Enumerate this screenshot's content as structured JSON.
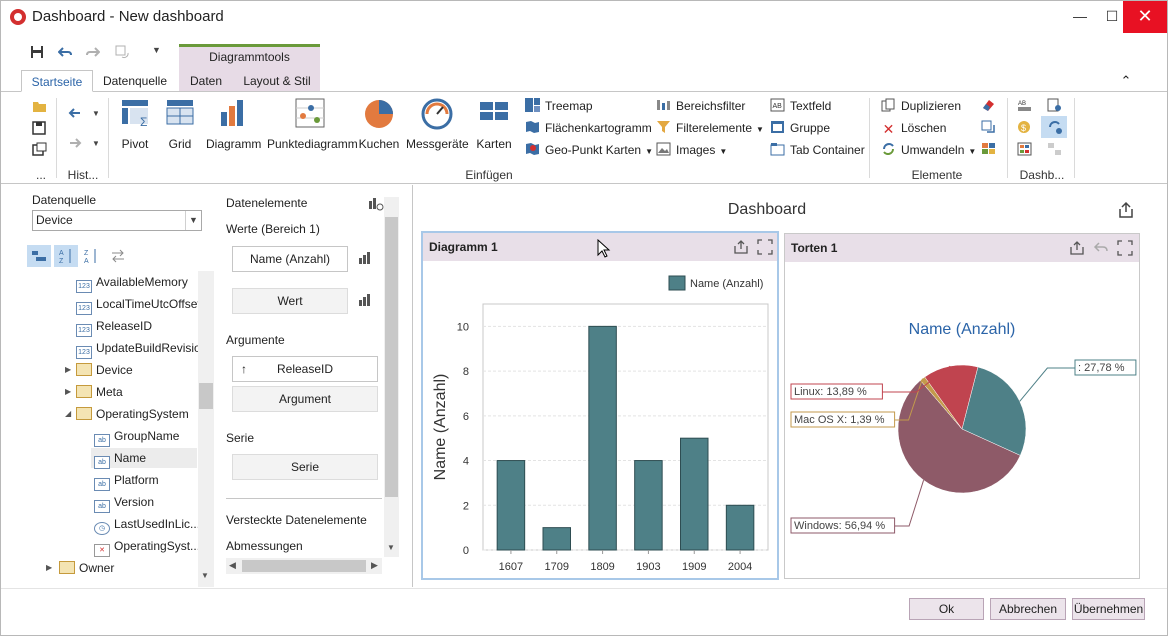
{
  "window": {
    "title": "Dashboard - New dashboard",
    "minimize": "—",
    "maximize": "☐",
    "close": "✕"
  },
  "ribbon": {
    "context_title": "Diagrammtools",
    "tabs": [
      "Startseite",
      "Datenquelle",
      "Daten",
      "Layout & Stil"
    ],
    "collapse": "⌃",
    "groups": {
      "history_label": "Hist...",
      "first_label": "...",
      "insert_label": "Einfügen",
      "elements_label": "Elemente",
      "dashboard_label": "Dashb..."
    },
    "insert_big": [
      "Pivot",
      "Grid",
      "Diagramm",
      "Punktediagramm",
      "Kuchen",
      "Messgeräte",
      "Karten"
    ],
    "insert_small_col1": [
      "Treemap",
      "Flächenkartogramm",
      "Geo-Punkt Karten"
    ],
    "insert_small_col2": [
      "Bereichsfilter",
      "Filterelemente",
      "Images"
    ],
    "insert_small_col3": [
      "Textfeld",
      "Gruppe",
      "Tab Container"
    ],
    "elements_small": [
      "Duplizieren",
      "Löschen",
      "Umwandeln"
    ]
  },
  "datasource": {
    "label": "Datenquelle",
    "selected": "Device",
    "tree": [
      {
        "label": "AvailableMemory",
        "type": "123"
      },
      {
        "label": "LocalTimeUtcOffset",
        "type": "123"
      },
      {
        "label": "ReleaseID",
        "type": "123"
      },
      {
        "label": "UpdateBuildRevision",
        "type": "123"
      },
      {
        "label": "Device",
        "type": "table"
      },
      {
        "label": "Meta",
        "type": "table"
      },
      {
        "label": "OperatingSystem",
        "type": "table"
      },
      {
        "label": "GroupName",
        "type": "ab"
      },
      {
        "label": "Name",
        "type": "ab"
      },
      {
        "label": "Platform",
        "type": "ab"
      },
      {
        "label": "Version",
        "type": "ab"
      },
      {
        "label": "LastUsedInLic...",
        "type": "clock"
      },
      {
        "label": "OperatingSyst...",
        "type": "x"
      },
      {
        "label": "Owner",
        "type": "table"
      }
    ]
  },
  "data_items": {
    "header": "Datenelemente",
    "values_section": "Werte (Bereich 1)",
    "value_item": "Name (Anzahl)",
    "value_placeholder": "Wert",
    "arguments_section": "Argumente",
    "argument_item": "ReleaseID",
    "argument_placeholder": "Argument",
    "series_section": "Serie",
    "series_placeholder": "Serie",
    "hidden_section": "Versteckte Datenelemente",
    "dimensions_section": "Abmessungen"
  },
  "dashboard": {
    "title": "Dashboard",
    "chart_panel_title": "Diagramm 1",
    "pie_panel_title": "Torten 1"
  },
  "chart_data": [
    {
      "type": "bar",
      "title": "",
      "categories": [
        "1607",
        "1709",
        "1809",
        "1903",
        "1909",
        "2004"
      ],
      "series": [
        {
          "name": "Name (Anzahl)",
          "values": [
            4,
            1,
            10,
            4,
            5,
            2
          ]
        }
      ],
      "ylabel": "Name (Anzahl)",
      "xlabel": "",
      "ylim": [
        0,
        11
      ],
      "yticks": [
        0,
        2,
        4,
        6,
        8,
        10
      ],
      "grid": true,
      "legend": "top-right",
      "color": "#4e8087"
    },
    {
      "type": "pie",
      "title": "Name (Anzahl)",
      "slices": [
        {
          "label": "",
          "value": 27.78,
          "text": ": 27,78 %",
          "color": "#4e8087"
        },
        {
          "label": "Windows",
          "value": 56.94,
          "text": "Windows: 56,94 %",
          "color": "#8e5a68"
        },
        {
          "label": "Mac OS X",
          "value": 1.39,
          "text": "Mac OS X: 1,39 %",
          "color": "#c39a4c"
        },
        {
          "label": "Linux",
          "value": 13.89,
          "text": "Linux: 13,89 %",
          "color": "#c0444f"
        }
      ],
      "legend": "none"
    }
  ],
  "footer": {
    "ok": "Ok",
    "cancel": "Abbrechen",
    "apply": "Übernehmen"
  }
}
